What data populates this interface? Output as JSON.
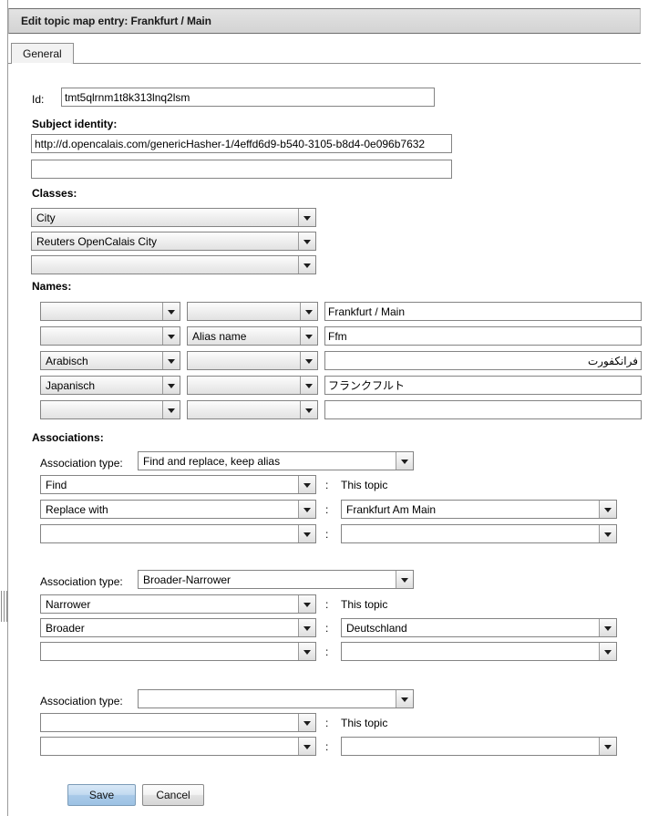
{
  "window": {
    "title": "Edit topic map entry: Frankfurt / Main"
  },
  "tabs": [
    {
      "label": "General",
      "selected": true
    }
  ],
  "form": {
    "id_label": "Id:",
    "id_value": "tmt5qlrnm1t8k313lnq2lsm",
    "subject_identity_label": "Subject identity:",
    "subject_identity_values": [
      "http://d.opencalais.com/genericHasher-1/4effd6d9-b540-3105-b8d4-0e096b7632",
      ""
    ],
    "classes_label": "Classes:",
    "classes": [
      "City",
      "Reuters OpenCalais City",
      ""
    ],
    "names_label": "Names:",
    "names": [
      {
        "language": "",
        "type": "",
        "value": "Frankfurt / Main",
        "rtl": false
      },
      {
        "language": "",
        "type": "Alias name",
        "value": "Ffm",
        "rtl": false
      },
      {
        "language": "Arabisch",
        "type": "",
        "value": "فرانكفورت",
        "rtl": true
      },
      {
        "language": "Japanisch",
        "type": "",
        "value": "フランクフルト",
        "rtl": false
      },
      {
        "language": "",
        "type": "",
        "value": "",
        "rtl": false
      }
    ],
    "associations_label": "Associations:",
    "association_type_label": "Association type:",
    "this_topic_label": "This topic",
    "colon": ":",
    "associations": [
      {
        "type": "Find and replace, keep alias",
        "roles": [
          {
            "role": "Find",
            "player": "This topic",
            "player_is_static": true
          },
          {
            "role": "Replace with",
            "player": "Frankfurt Am Main",
            "player_is_static": false
          },
          {
            "role": "",
            "player": "",
            "player_is_static": false
          }
        ]
      },
      {
        "type": "Broader-Narrower",
        "roles": [
          {
            "role": "Narrower",
            "player": "This topic",
            "player_is_static": true
          },
          {
            "role": "Broader",
            "player": "Deutschland",
            "player_is_static": false
          },
          {
            "role": "",
            "player": "",
            "player_is_static": false
          }
        ]
      },
      {
        "type": "",
        "roles": [
          {
            "role": "",
            "player": "This topic",
            "player_is_static": true
          },
          {
            "role": "",
            "player": "",
            "player_is_static": false
          }
        ]
      }
    ]
  },
  "buttons": {
    "save_label": "Save",
    "cancel_label": "Cancel"
  },
  "colors": {
    "title_bar": "#dadada",
    "primary_button": "#a8c9e8",
    "border": "#848484"
  }
}
